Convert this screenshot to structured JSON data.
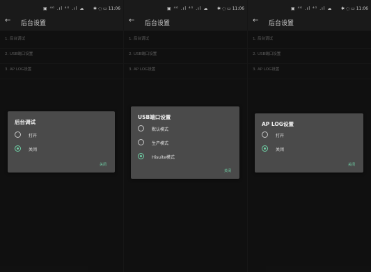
{
  "screens": [
    {
      "status": {
        "icons": "▣ ⁴ᴳ .ıl ⁴ᴳ .ıl ☁",
        "right": "✱ ◌ ▭ 11:06"
      },
      "header": {
        "back": "←",
        "title": "后台设置"
      },
      "menu": [
        "1. 后台调试",
        "2. USB端口设置",
        "3. AP LOG设置"
      ],
      "dialog": {
        "title": "后台调试",
        "options": [
          {
            "label": "打开",
            "selected": false
          },
          {
            "label": "关闭",
            "selected": true
          }
        ],
        "button": "关闭"
      }
    },
    {
      "status": {
        "icons": "▣ ⁴ᴳ .ıl ⁴ᴳ .ıl ☁",
        "right": "✱ ◌ ▭ 11:06"
      },
      "header": {
        "back": "←",
        "title": "后台设置"
      },
      "menu": [
        "1. 后台调试",
        "2. USB端口设置",
        "3. AP LOG设置"
      ],
      "dialog": {
        "title": "USB端口设置",
        "options": [
          {
            "label": "默认模式",
            "selected": false
          },
          {
            "label": "生产模式",
            "selected": false
          },
          {
            "label": "Hisuite模式",
            "selected": true
          }
        ],
        "button": "关闭"
      }
    },
    {
      "status": {
        "icons": "▣ ⁴ᴳ .ıl ⁴ᴳ .ıl ☁",
        "right": "✱ ◌ ▭ 11:06"
      },
      "header": {
        "back": "←",
        "title": "后台设置"
      },
      "menu": [
        "1. 后台调试",
        "2. USB端口设置",
        "3. AP LOG设置"
      ],
      "dialog": {
        "title": "AP LOG设置",
        "options": [
          {
            "label": "打开",
            "selected": false
          },
          {
            "label": "关闭",
            "selected": true
          }
        ],
        "button": "关闭"
      }
    }
  ],
  "colors": {
    "accent": "#6fd0a6",
    "dialog_bg": "#4a4a4a",
    "screen_bg": "#1a1a1a"
  }
}
